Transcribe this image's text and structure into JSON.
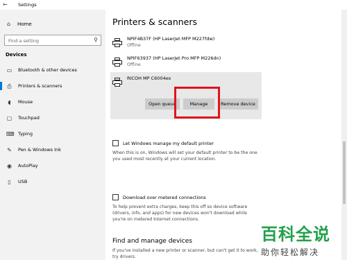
{
  "window": {
    "title": "Settings",
    "back_icon": "back-arrow-icon"
  },
  "sidebar": {
    "home": "Home",
    "search_placeholder": "Find a setting",
    "section": "Devices",
    "items": [
      {
        "label": "Bluetooth & other devices",
        "icon": "bluetooth-icon"
      },
      {
        "label": "Printers & scanners",
        "icon": "printer-icon",
        "active": true
      },
      {
        "label": "Mouse",
        "icon": "mouse-icon"
      },
      {
        "label": "Touchpad",
        "icon": "touchpad-icon"
      },
      {
        "label": "Typing",
        "icon": "keyboard-icon"
      },
      {
        "label": "Pen & Windows Ink",
        "icon": "pen-icon"
      },
      {
        "label": "AutoPlay",
        "icon": "autoplay-icon"
      },
      {
        "label": "USB",
        "icon": "usb-icon"
      }
    ]
  },
  "main": {
    "title": "Printers & scanners",
    "printers": [
      {
        "name": "NPIF4B37F (HP LaserJet MFP M227fdw)",
        "status": "Offline"
      },
      {
        "name": "NPIF63937 (HP LaserJet Pro MFP M226dn)",
        "status": "Offline"
      },
      {
        "name": "RICOH MP C6004ex",
        "status": ""
      }
    ],
    "buttons": {
      "open_queue": "Open queue",
      "manage": "Manage",
      "remove": "Remove device"
    },
    "default_printer": {
      "label": "Let Windows manage my default printer",
      "desc": "When this is on, Windows will set your default printer to be the one you used most recently at your current location."
    },
    "metered": {
      "label": "Download over metered connections",
      "desc": "To help prevent extra charges, keep this off so device software (drivers, info, and apps) for new devices won't download while you're on metered Internet connections."
    },
    "find_title": "Find and manage devices",
    "find_desc": "If you've installed a new printer or scanner, but can't get it to work, try drivers."
  },
  "watermark": {
    "big": "百科全说",
    "small": "助你轻松解决"
  },
  "colors": {
    "accent": "#0078d7",
    "highlight": "#e0131b",
    "watermark": "#22a04a"
  }
}
